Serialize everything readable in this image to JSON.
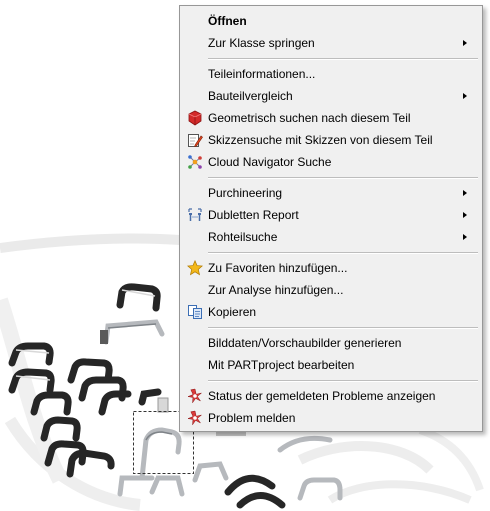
{
  "menu": {
    "items": [
      {
        "label": "Öffnen",
        "bold": true,
        "icon": "",
        "submenu": false
      },
      {
        "label": "Zur Klasse springen",
        "icon": "",
        "submenu": true
      },
      {
        "label": "Teileinformationen...",
        "icon": "",
        "submenu": false
      },
      {
        "label": "Bauteilvergleich",
        "icon": "",
        "submenu": true
      },
      {
        "label": "Geometrisch suchen nach diesem Teil",
        "icon": "red-cube-icon",
        "submenu": false
      },
      {
        "label": "Skizzensuche mit Skizzen von diesem Teil",
        "icon": "sketch-pencil-icon",
        "submenu": false
      },
      {
        "label": "Cloud Navigator Suche",
        "icon": "cloud-network-icon",
        "submenu": false
      },
      {
        "label": "Purchineering",
        "icon": "",
        "submenu": true
      },
      {
        "label": "Dubletten Report",
        "icon": "duplicate-report-icon",
        "submenu": true
      },
      {
        "label": "Rohteilsuche",
        "icon": "",
        "submenu": true
      },
      {
        "label": "Zu Favoriten hinzufügen...",
        "icon": "star-icon",
        "submenu": false
      },
      {
        "label": "Zur Analyse hinzufügen...",
        "icon": "",
        "submenu": false
      },
      {
        "label": "Kopieren",
        "icon": "copy-icon",
        "submenu": false
      },
      {
        "label": "Bilddaten/Vorschaubilder generieren",
        "icon": "",
        "submenu": false
      },
      {
        "label": "Mit PARTproject bearbeiten",
        "icon": "",
        "submenu": false
      },
      {
        "label": "Status der gemeldeten Probleme anzeigen",
        "icon": "problem-status-icon",
        "submenu": false
      },
      {
        "label": "Problem melden",
        "icon": "report-problem-icon",
        "submenu": false
      }
    ]
  },
  "colors": {
    "menu_background": "#f0f0f0",
    "menu_border": "#979797",
    "handle_dark": "#262626",
    "handle_silver": "#b8bcc0"
  }
}
